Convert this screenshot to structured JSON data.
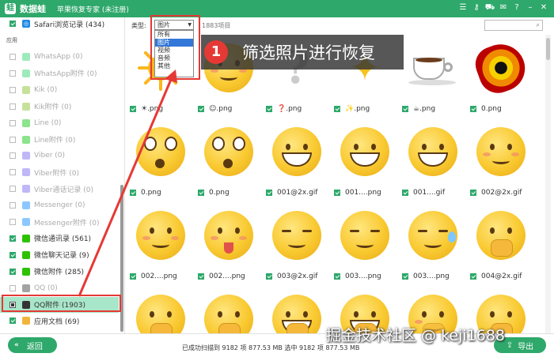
{
  "titlebar": {
    "logo": "蛙",
    "app_name": "数据蛙",
    "subtitle": "苹果恢复专家 (未注册)",
    "icons": [
      "menu-icon",
      "key-icon",
      "cart-icon",
      "chat-icon",
      "help-icon",
      "minimize-icon",
      "close-icon"
    ]
  },
  "sidebar": {
    "top_item": "Safari浏览记录 (434)",
    "section_heading": "应用",
    "items": [
      {
        "label": "WhatsApp (0)",
        "icon": "whatsapp-icon",
        "color": "#25d366",
        "checked": false,
        "dim": true
      },
      {
        "label": "WhatsApp附件 (0)",
        "icon": "whatsapp-icon",
        "color": "#25d366",
        "checked": false,
        "dim": true
      },
      {
        "label": "Kik (0)",
        "icon": "kik-icon",
        "color": "#82bc23",
        "checked": false,
        "dim": true
      },
      {
        "label": "Kik附件 (0)",
        "icon": "kik-icon",
        "color": "#82bc23",
        "checked": false,
        "dim": true
      },
      {
        "label": "Line (0)",
        "icon": "line-icon",
        "color": "#00c300",
        "checked": false,
        "dim": true
      },
      {
        "label": "Line附件 (0)",
        "icon": "line-icon",
        "color": "#00c300",
        "checked": false,
        "dim": true
      },
      {
        "label": "Viber (0)",
        "icon": "viber-icon",
        "color": "#7360f2",
        "checked": false,
        "dim": true
      },
      {
        "label": "Viber附件 (0)",
        "icon": "viber-icon",
        "color": "#7360f2",
        "checked": false,
        "dim": true
      },
      {
        "label": "Viber通话记录 (0)",
        "icon": "viber-icon",
        "color": "#7360f2",
        "checked": false,
        "dim": true
      },
      {
        "label": "Messenger (0)",
        "icon": "messenger-icon",
        "color": "#0084ff",
        "checked": false,
        "dim": true
      },
      {
        "label": "Messenger附件 (0)",
        "icon": "messenger-icon",
        "color": "#0084ff",
        "checked": false,
        "dim": true
      },
      {
        "label": "微信通讯录 (561)",
        "icon": "wechat-icon",
        "color": "#2dc100",
        "checked": true,
        "dim": false
      },
      {
        "label": "微信聊天记录 (9)",
        "icon": "wechat-icon",
        "color": "#2dc100",
        "checked": true,
        "dim": false
      },
      {
        "label": "微信附件 (285)",
        "icon": "wechat-icon",
        "color": "#2dc100",
        "checked": true,
        "dim": false
      },
      {
        "label": "QQ (0)",
        "icon": "qq-icon",
        "color": "#333333",
        "checked": false,
        "dim": true
      },
      {
        "label": "QQ附件 (1903)",
        "icon": "qq-icon",
        "color": "#333333",
        "checked": "half",
        "dim": false,
        "active": true
      },
      {
        "label": "应用文档 (69)",
        "icon": "folder-icon",
        "color": "#f1b53c",
        "checked": true,
        "dim": false
      }
    ]
  },
  "toolbar": {
    "type_label": "类型:",
    "type_selected": "图片",
    "item_count": "1883项目",
    "search_icon": "search-icon"
  },
  "type_dropdown": {
    "options": [
      "所有",
      "图片",
      "视频",
      "音频",
      "其他"
    ],
    "selected_index": 1
  },
  "callout": {
    "number": "1",
    "text": "筛选照片进行恢复"
  },
  "grid": {
    "items": [
      {
        "name": "☀.png",
        "kind": "sun"
      },
      {
        "name": "☺.png",
        "kind": "face blush"
      },
      {
        "name": "❓.png",
        "kind": "qmark"
      },
      {
        "name": "✨.png",
        "kind": "sparkle"
      },
      {
        "name": "☕.png",
        "kind": "cup"
      },
      {
        "name": "0.png",
        "kind": "donut"
      },
      {
        "name": "0.png",
        "kind": "face wide"
      },
      {
        "name": "0.png",
        "kind": "face wide"
      },
      {
        "name": "001@2x.gif",
        "kind": "face grin"
      },
      {
        "name": "001....png",
        "kind": "face grin"
      },
      {
        "name": "001....gif",
        "kind": "face grin"
      },
      {
        "name": "002@2x.gif",
        "kind": "face blush"
      },
      {
        "name": "002....png",
        "kind": "face blush"
      },
      {
        "name": "002....png",
        "kind": "face tongue blush"
      },
      {
        "name": "003@2x.gif",
        "kind": "face squint"
      },
      {
        "name": "003....png",
        "kind": "face squint"
      },
      {
        "name": "003....png",
        "kind": "face squint sweat"
      },
      {
        "name": "004@2x.gif",
        "kind": "face hand"
      },
      {
        "name": "",
        "kind": "face hand"
      },
      {
        "name": "",
        "kind": "face hand"
      },
      {
        "name": "",
        "kind": "face grin hand"
      },
      {
        "name": "",
        "kind": "face grin hand"
      },
      {
        "name": "",
        "kind": "face hand blush"
      },
      {
        "name": "",
        "kind": "face hand"
      }
    ]
  },
  "bottom": {
    "back_label": "返回",
    "back_icon": "double-chevron-left-icon",
    "status": "已成功扫描到 9182 项 877.53 MB  选中 9182 项 877.53 MB",
    "export_label": "导出",
    "export_icon": "export-icon"
  },
  "watermark": "掘金技术社区 @ keji1688",
  "colors": {
    "brand": "#2ea86b",
    "highlight": "#e53935",
    "active_row": "#a8e6c9"
  }
}
